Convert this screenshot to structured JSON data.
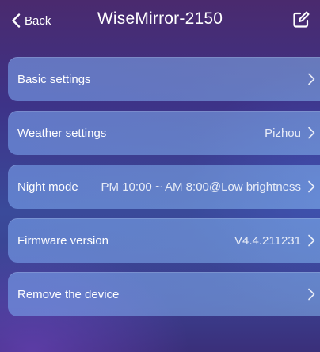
{
  "header": {
    "back_label": "Back",
    "title": "WiseMirror-2150",
    "back_icon": "chevron-left-icon",
    "edit_icon": "edit-icon"
  },
  "rows": [
    {
      "label": "Basic settings",
      "value": ""
    },
    {
      "label": "Weather settings",
      "value": "Pizhou"
    },
    {
      "label": "Night mode",
      "value": "PM 10:00 ~ AM 8:00@Low brightness"
    },
    {
      "label": "Firmware version",
      "value": "V4.4.211231"
    },
    {
      "label": "Remove the device",
      "value": ""
    }
  ],
  "colors": {
    "background_top": "#4a2a6e",
    "background_mid": "#3a4a9a",
    "row_fill": "#7fa6ec",
    "text": "#ffffff"
  }
}
